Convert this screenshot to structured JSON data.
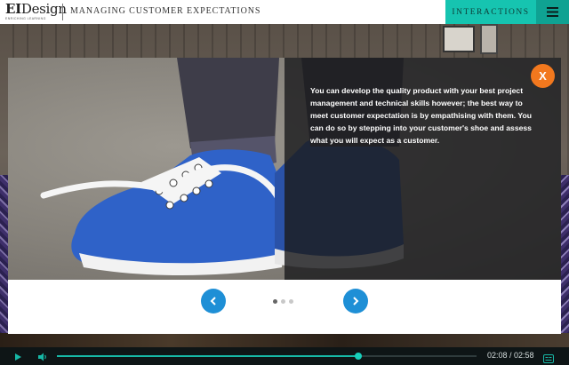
{
  "header": {
    "logo_primary": "EI",
    "logo_secondary": "Design",
    "logo_tagline": "ENRICHING LEARNING",
    "course_title": "MANAGING CUSTOMER EXPECTATIONS",
    "interactions_label": "INTERACTIONS",
    "menu_icon": "hamburger-menu-icon"
  },
  "slide": {
    "body_text": "You can develop the quality product with your best project management and technical skills however; the best way to meet customer expectation is by empathising with them. You can do so by stepping into your customer's shoe and assess what you will expect as a customer.",
    "close_label": "X",
    "prev_icon": "chevron-left-icon",
    "next_icon": "chevron-right-icon",
    "page_count": 3,
    "current_page": 1
  },
  "player": {
    "play_icon": "play-icon",
    "volume_icon": "volume-icon",
    "captions_icon": "closed-captions-icon",
    "time_display": "02:08 / 02:58",
    "progress_fraction": 0.719
  },
  "colors": {
    "accent_teal": "#16c4b0",
    "accent_teal_dark": "#0fa292",
    "close_orange": "#f2781e",
    "nav_blue": "#1e8fd6"
  }
}
